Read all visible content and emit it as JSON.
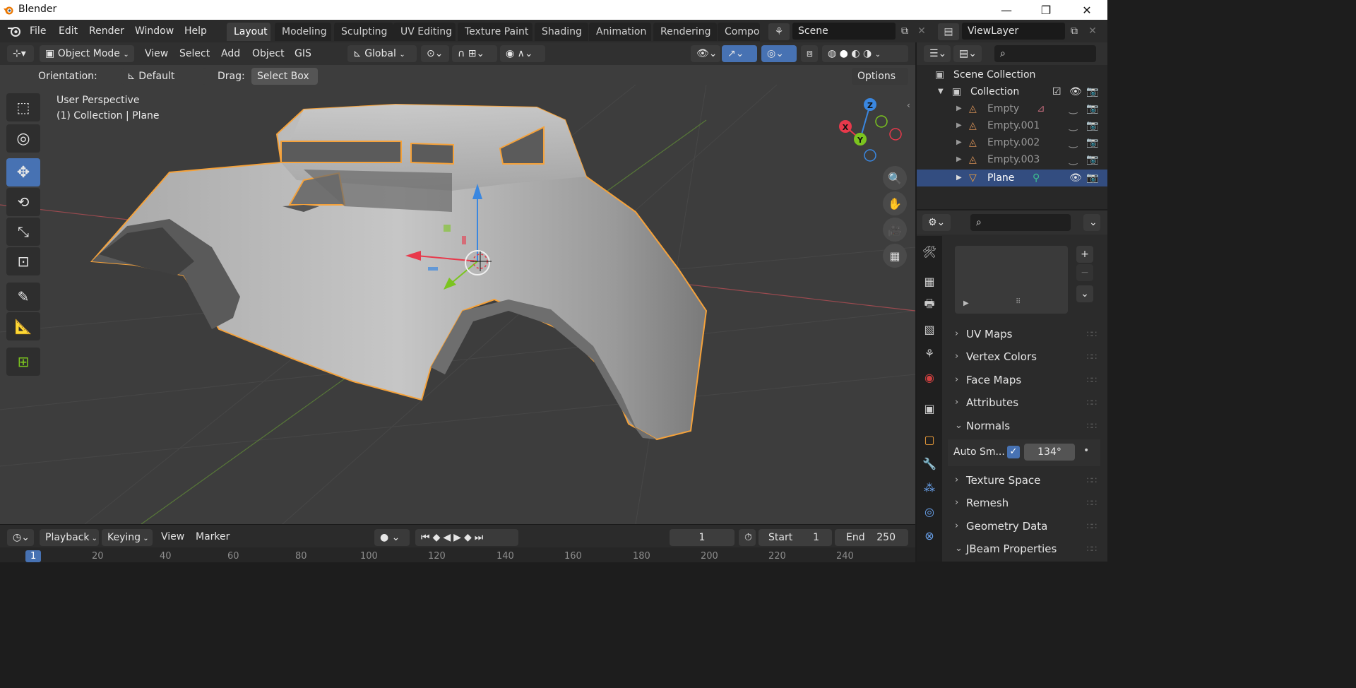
{
  "window": {
    "title": "Blender",
    "controls": [
      "minimize",
      "maximize",
      "close"
    ]
  },
  "menubar": {
    "items": [
      "File",
      "Edit",
      "Render",
      "Window",
      "Help"
    ],
    "workspaces": [
      "Layout",
      "Modeling",
      "Sculpting",
      "UV Editing",
      "Texture Paint",
      "Shading",
      "Animation",
      "Rendering",
      "Compo"
    ],
    "active_workspace": "Layout",
    "scene": "Scene",
    "view_layer": "ViewLayer"
  },
  "viewport_header": {
    "mode": "Object Mode",
    "menus": [
      "View",
      "Select",
      "Add",
      "Object",
      "GIS"
    ],
    "transform_orientation": "Global"
  },
  "tool_settings": {
    "orientation_label": "Orientation:",
    "orientation_value": "Default",
    "drag_label": "Drag:",
    "drag_value": "Select Box",
    "options_label": "Options"
  },
  "viewport_overlay": {
    "view_name": "User Perspective",
    "context": "(1) Collection | Plane"
  },
  "gizmo": {
    "x": "X",
    "y": "Y",
    "z": "Z"
  },
  "outliner": {
    "root": "Scene Collection",
    "collection": "Collection",
    "items": [
      {
        "name": "Empty",
        "selected": false
      },
      {
        "name": "Empty.001",
        "selected": false
      },
      {
        "name": "Empty.002",
        "selected": false
      },
      {
        "name": "Empty.003",
        "selected": false
      },
      {
        "name": "Plane",
        "selected": true
      }
    ]
  },
  "properties": {
    "panels": [
      "UV Maps",
      "Vertex Colors",
      "Face Maps",
      "Attributes",
      "Normals",
      "Texture Space",
      "Remesh",
      "Geometry Data",
      "JBeam Properties"
    ],
    "normals_open": true,
    "auto_smooth_label": "Auto Sm...",
    "auto_smooth_checked": true,
    "auto_smooth_angle": "134°"
  },
  "timeline": {
    "menus": [
      "Playback",
      "Keying",
      "View",
      "Marker"
    ],
    "current_frame": "1",
    "start_label": "Start",
    "start_value": "1",
    "end_label": "End",
    "end_value": "250",
    "ruler_ticks": [
      "1",
      "20",
      "40",
      "60",
      "80",
      "100",
      "120",
      "140",
      "160",
      "180",
      "200",
      "220",
      "240"
    ]
  },
  "colors": {
    "selection_outline": "#f5a23b",
    "active_tool": "#4772b3",
    "selected_row": "#334d80",
    "axis_x": "#e8394b",
    "axis_y": "#7bc41f",
    "axis_z": "#3a87e0"
  }
}
